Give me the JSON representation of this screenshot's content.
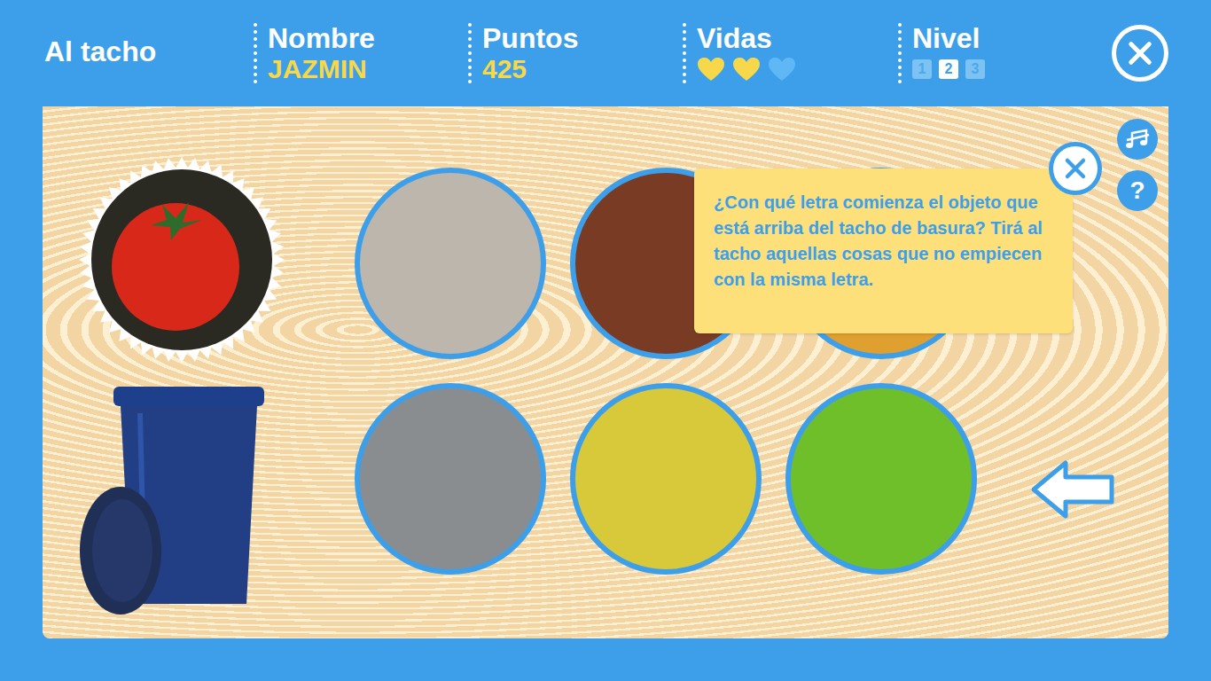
{
  "header": {
    "title": "Al tacho",
    "player": {
      "label": "Nombre",
      "value": "JAZMIN"
    },
    "score": {
      "label": "Puntos",
      "value": "425"
    },
    "lives": {
      "label": "Vidas",
      "hearts": [
        {
          "filled": true
        },
        {
          "filled": true
        },
        {
          "filled": false
        }
      ]
    },
    "level": {
      "label": "Nivel",
      "levels": [
        {
          "label": "1",
          "selected": false
        },
        {
          "label": "2",
          "selected": true
        },
        {
          "label": "3",
          "selected": false
        }
      ]
    }
  },
  "target": {
    "color": "#d8281a"
  },
  "pictures": [
    {
      "color": "#bdb6ad"
    },
    {
      "color": "#7a3b25"
    },
    {
      "color": "#e0a030"
    },
    {
      "color": "#8a8d8f"
    },
    {
      "color": "#d8c93a"
    },
    {
      "color": "#6fbf2a"
    }
  ],
  "tooltip": {
    "text": "¿Con qué letra comienza el objeto que está arriba del tacho de basura? Tirá al tacho aquellas cosas que no empiecen con la misma letra."
  },
  "help": {
    "label": "?"
  }
}
